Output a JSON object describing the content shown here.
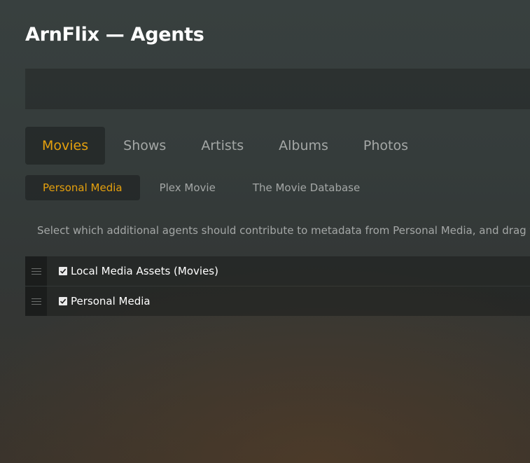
{
  "page": {
    "title": "ArnFlix — Agents"
  },
  "main_tabs": [
    {
      "label": "Movies",
      "active": true
    },
    {
      "label": "Shows",
      "active": false
    },
    {
      "label": "Artists",
      "active": false
    },
    {
      "label": "Albums",
      "active": false
    },
    {
      "label": "Photos",
      "active": false
    }
  ],
  "sub_tabs": [
    {
      "label": "Personal Media",
      "active": true
    },
    {
      "label": "Plex Movie",
      "active": false
    },
    {
      "label": "The Movie Database",
      "active": false
    }
  ],
  "description": "Select which additional agents should contribute to metadata from Personal Media, and drag t",
  "agents": [
    {
      "label": "Local Media Assets (Movies)",
      "checked": true
    },
    {
      "label": "Personal Media",
      "checked": true
    }
  ],
  "icons": {
    "drag_handle": "drag-handle-icon",
    "checkbox": "checkmark-icon"
  },
  "colors": {
    "accent": "#e5a00d",
    "inactive_text": "#a4a7a6",
    "text": "#ffffff"
  }
}
